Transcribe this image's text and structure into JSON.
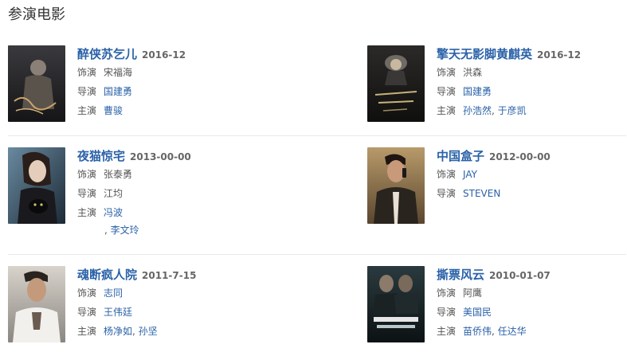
{
  "section_title": "参演电影",
  "movies": [
    {
      "title": "醉侠苏乞儿",
      "date": "2016-12",
      "role_label": "饰演",
      "role": "宋福海",
      "director_label": "导演",
      "director": "国建勇",
      "cast_label": "主演",
      "cast": [
        "曹骏"
      ]
    },
    {
      "title": "擎天无影脚黄麒英",
      "date": "2016-12",
      "role_label": "饰演",
      "role": "洪森",
      "director_label": "导演",
      "director": "国建勇",
      "cast_label": "主演",
      "cast": [
        "孙浩然",
        "于彦凯"
      ]
    },
    {
      "title": "夜猫惊宅",
      "date": "2013-00-00",
      "role_label": "饰演",
      "role": "张泰勇",
      "director_label": "导演",
      "director": "江均",
      "cast_label": "主演",
      "cast": [
        "冯波",
        "李文玲"
      ]
    },
    {
      "title": "中国盒子",
      "date": "2012-00-00",
      "role_label": "饰演",
      "role": "JAY",
      "director_label": "导演",
      "director": "STEVEN"
    },
    {
      "title": "魂断疯人院",
      "date": "2011-7-15",
      "role_label": "饰演",
      "role": "志同",
      "director_label": "导演",
      "director": "王伟廷",
      "cast_label": "主演",
      "cast": [
        "杨净如",
        "孙坚"
      ]
    },
    {
      "title": "撕票风云",
      "date": "2010-01-07",
      "role_label": "饰演",
      "role": "阿鹰",
      "director_label": "导演",
      "director": "美国民",
      "cast_label": "主演",
      "cast": [
        "苗侨伟",
        "任达华"
      ]
    }
  ],
  "cast_separator": ", ",
  "colors": {
    "link": "#2b62a8",
    "label": "#555555",
    "divider": "#e8e8e8"
  }
}
